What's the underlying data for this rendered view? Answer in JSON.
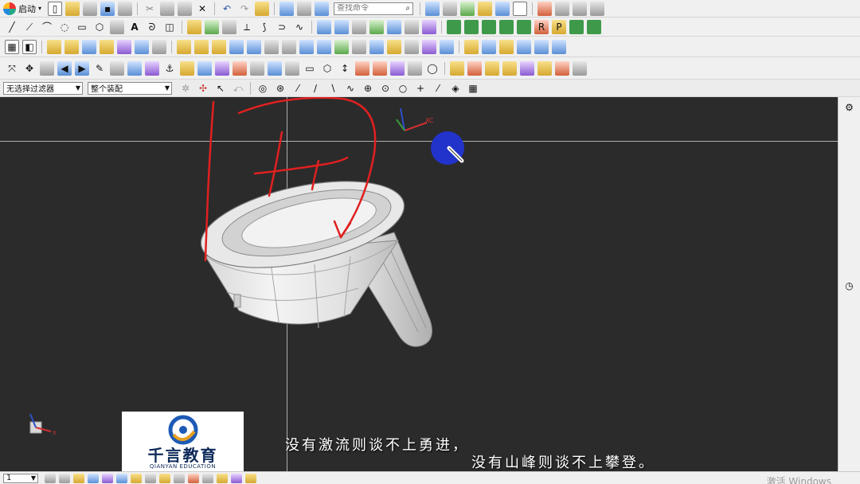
{
  "toolbar": {
    "start_label": "启动",
    "search_placeholder": "查找命令"
  },
  "filter_bar": {
    "selection_filter": "无选择过滤器",
    "assembly_scope": "整个装配"
  },
  "viewport": {
    "axis_label_xc": "XC",
    "triad_label_x": "X",
    "annotation_text": "H"
  },
  "overlay": {
    "brand_name": "千言教育",
    "brand_subtitle": "QIANYAN EDUCATION",
    "subtitle_line1": "没有激流则谈不上勇进，",
    "subtitle_line2": "没有山峰则谈不上攀登。"
  },
  "statusbar": {
    "zoom_value": "1",
    "os_watermark": "激活 Windows"
  },
  "colors": {
    "viewport_bg": "#2b2b2b",
    "annotation_red": "#e02020",
    "cursor_blue": "#2233cc",
    "brand_navy": "#0e2a5a"
  },
  "icons": [
    "start-icon",
    "new-file-icon",
    "open-folder-icon",
    "save-icon",
    "print-icon",
    "cut-icon",
    "copy-icon",
    "paste-icon",
    "delete-icon",
    "undo-icon",
    "redo-icon",
    "search-icon",
    "render-style-icon",
    "line-icon",
    "arc-icon",
    "circle-icon",
    "rectangle-icon",
    "text-icon",
    "extrude-icon",
    "revolve-icon",
    "gear-icon",
    "clock-icon",
    "palette-icon"
  ]
}
